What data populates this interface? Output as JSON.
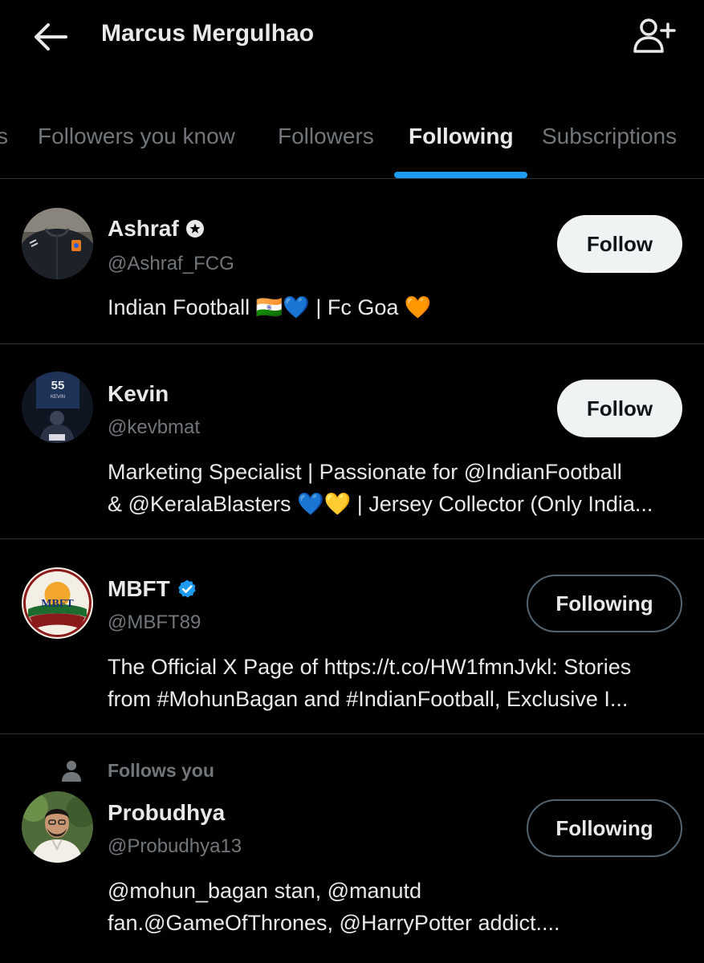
{
  "header": {
    "title": "Marcus Mergulhao",
    "back_icon": "arrow-left-icon",
    "add_icon": "person-add-icon"
  },
  "tabs": [
    {
      "label": "s",
      "active": false
    },
    {
      "label": "Followers you know",
      "active": false
    },
    {
      "label": "Followers",
      "active": false
    },
    {
      "label": "Following",
      "active": true
    },
    {
      "label": "Subscriptions",
      "active": false
    }
  ],
  "colors": {
    "accent": "#1d9bf0",
    "background": "#000000",
    "text": "#e7e9ea",
    "muted": "#71767b"
  },
  "users": [
    {
      "name": "Ashraf",
      "badge": "circle-star-badge-icon",
      "handle": "@Ashraf_FCG",
      "bio": [
        "Indian Football 🇮🇳💙 | Fc Goa 🧡"
      ],
      "button": "Follow"
    },
    {
      "name": "Kevin",
      "handle": "@kevbmat",
      "bio": [
        "Marketing Specialist | Passionate for @IndianFootball",
        "& @KeralaBlasters 💙💛 | Jersey Collector (Only India..."
      ],
      "button": "Follow",
      "avatar_text": {
        "number": "55",
        "name": "KEVIN"
      }
    },
    {
      "name": "MBFT",
      "badge": "verified-badge-icon",
      "handle": "@MBFT89",
      "bio": [
        "The Official X Page of https://t.co/HW1fmnJvkl: Stories",
        "from #MohunBagan and #IndianFootball, Exclusive I..."
      ],
      "button": "Following",
      "avatar_text": "MBFT"
    },
    {
      "follows_you": "Follows you",
      "name": "Probudhya",
      "handle": "@Probudhya13",
      "bio": [
        "@mohun_bagan stan, @manutd",
        "fan.@GameOfThrones, @HarryPotter addict...."
      ],
      "button": "Following"
    }
  ]
}
